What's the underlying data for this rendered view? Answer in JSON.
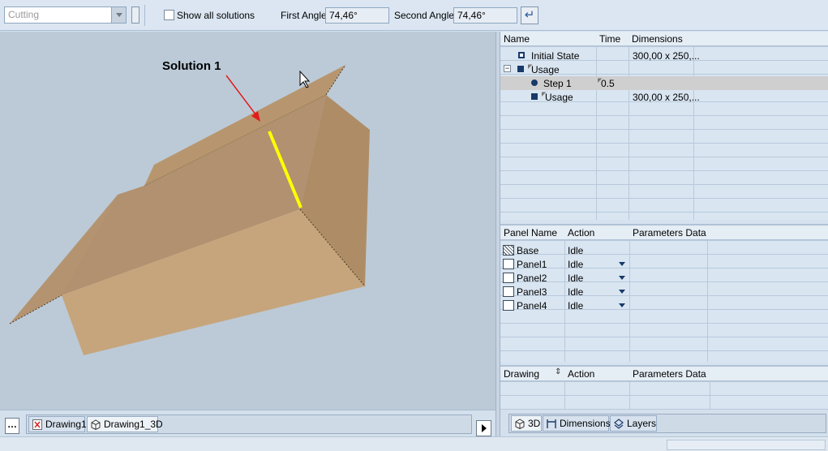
{
  "toolbar": {
    "mode_value": "Cutting",
    "show_all_label": "Show all solutions",
    "first_angle_label": "First Angle",
    "first_angle_value": "74,46°",
    "second_angle_label": "Second Angle",
    "second_angle_value": "74,46°"
  },
  "viewport": {
    "annotation": "Solution 1"
  },
  "drawing_tabs": [
    "Drawing1",
    "Drawing1_3D"
  ],
  "steps_table": {
    "columns": [
      "Name",
      "Time",
      "Dimensions"
    ],
    "rows": [
      {
        "name": "Initial State",
        "time": "",
        "dimensions": "300,00 x 250,..."
      },
      {
        "name": "Usage",
        "time": "",
        "dimensions": ""
      },
      {
        "name": "Step 1",
        "time": "0.5",
        "dimensions": ""
      },
      {
        "name": "Usage",
        "time": "",
        "dimensions": "300,00 x 250,..."
      }
    ]
  },
  "panels_table": {
    "columns": [
      "Panel Name",
      "Action",
      "Parameters Data"
    ],
    "rows": [
      {
        "name": "Base",
        "action": "Idle"
      },
      {
        "name": "Panel1",
        "action": "Idle"
      },
      {
        "name": "Panel2",
        "action": "Idle"
      },
      {
        "name": "Panel3",
        "action": "Idle"
      },
      {
        "name": "Panel4",
        "action": "Idle"
      }
    ]
  },
  "drawing_table": {
    "columns": [
      "Drawing",
      "Action",
      "Parameters Data"
    ]
  },
  "right_tabs": [
    "3D",
    "Dimensions",
    "Layers"
  ],
  "colors": {
    "board": "#bd9c74",
    "highlight": "#ffff00",
    "arrow": "#e21b1b"
  }
}
